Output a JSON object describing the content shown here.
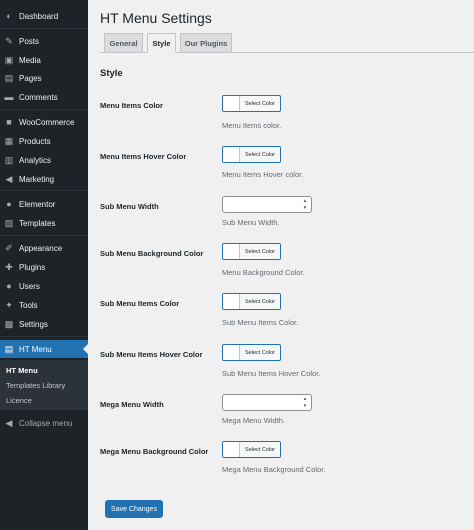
{
  "sidebar": {
    "items": [
      {
        "label": "Dashboard",
        "icon": "dashboard-icon",
        "glyph": "◐"
      },
      {
        "label": "Posts",
        "icon": "pin-icon",
        "glyph": "✎"
      },
      {
        "label": "Media",
        "icon": "media-icon",
        "glyph": "▣"
      },
      {
        "label": "Pages",
        "icon": "pages-icon",
        "glyph": "▤"
      },
      {
        "label": "Comments",
        "icon": "comments-icon",
        "glyph": "▬"
      },
      {
        "label": "WooCommerce",
        "icon": "woocommerce-icon",
        "glyph": "■"
      },
      {
        "label": "Products",
        "icon": "products-icon",
        "glyph": "▦"
      },
      {
        "label": "Analytics",
        "icon": "analytics-icon",
        "glyph": "▥"
      },
      {
        "label": "Marketing",
        "icon": "megaphone-icon",
        "glyph": "◀"
      },
      {
        "label": "Elementor",
        "icon": "elementor-icon",
        "glyph": "●"
      },
      {
        "label": "Templates",
        "icon": "templates-icon",
        "glyph": "▧"
      },
      {
        "label": "Appearance",
        "icon": "brush-icon",
        "glyph": "✐"
      },
      {
        "label": "Plugins",
        "icon": "plugins-icon",
        "glyph": "✚"
      },
      {
        "label": "Users",
        "icon": "users-icon",
        "glyph": "●"
      },
      {
        "label": "Tools",
        "icon": "wrench-icon",
        "glyph": "✦"
      },
      {
        "label": "Settings",
        "icon": "settings-icon",
        "glyph": "▩"
      },
      {
        "label": "HT Menu",
        "icon": "htmenu-icon",
        "glyph": "▤"
      }
    ],
    "submenu": [
      "HT Menu",
      "Templates Library",
      "Licence"
    ],
    "collapse_label": "Collapse menu"
  },
  "page": {
    "title": "HT Menu Settings",
    "tabs": [
      "General",
      "Style",
      "Our Plugins"
    ],
    "active_tab": "Style",
    "section_title": "Style",
    "fields": [
      {
        "label": "Menu Items Color",
        "type": "color",
        "button": "Select Color",
        "description": "Menu Items color."
      },
      {
        "label": "Menu Items Hover Color",
        "type": "color",
        "button": "Select Color",
        "description": "Menu Items Hover color."
      },
      {
        "label": "Sub Menu Width",
        "type": "number",
        "value": "",
        "description": "Sub Menu Width."
      },
      {
        "label": "Sub Menu Background Color",
        "type": "color",
        "button": "Select Color",
        "description": "Menu Background Color."
      },
      {
        "label": "Sub Menu Items Color",
        "type": "color",
        "button": "Select Color",
        "description": "Sub Menu Items Color."
      },
      {
        "label": "Sub Menu Items Hover Color",
        "type": "color",
        "button": "Select Color",
        "description": "Sub Menu Items Hover Color."
      },
      {
        "label": "Mega Menu Width",
        "type": "number",
        "value": "",
        "description": "Mega Menu Width."
      },
      {
        "label": "Mega Menu Background Color",
        "type": "color",
        "button": "Select Color",
        "description": "Mega Menu Background Color."
      }
    ],
    "save_label": "Save Changes"
  },
  "colors": {
    "accent": "#2271b1",
    "sidebar_bg": "#1d2327",
    "page_bg": "#f0f0f1"
  }
}
